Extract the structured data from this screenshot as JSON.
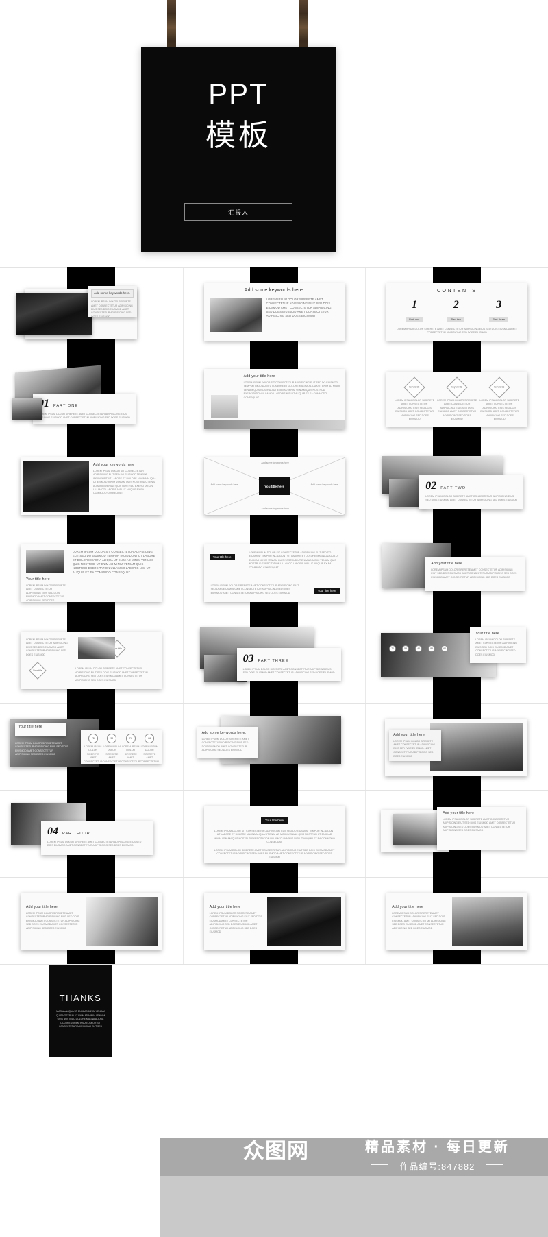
{
  "cover": {
    "title_en": "PPT",
    "title_cn": "模板",
    "button_label": "汇报人",
    "strap_left_name": "hanging-strap-left",
    "strap_right_name": "hanging-strap-right"
  },
  "common": {
    "lorem_short": "LOREM IPSUM DOLOR SIRERETE AMET CONSECTETUR ADIPISICING EIUS SED DOIS EIUSMOD AMET CONSECTETUR ADIPISICING SED DOES EIUSMOD",
    "lorem_mid": "LOREM IPSUM DOLOR SIRERETE AMET CONSECTETUR ADIPISICING EIUT SED DOIS EIUSMOD AMET CONSECTETUR ADIPISICING SED DOES EIUSMOD AMET CONSECTETUR ADIPISICING SED DOES EIUSMOD",
    "lorem_long": "LOREM IPSUM DOLOR SIT CONSECTETUR ADIPISICING ELIT SED DO EIUSMOD TEMPOR INCIDIDUNT UT LABORE ET DOLORE MAGNA ALIQUA UT ENIM AD MINIM VENIAM QUIS NOSTRUD UT ENIM AD MINIM VENIAM QUIS NOSTRUD EXERCITATION ULLAMCO LABORIS NISI UT ALIQUIP EX EA COMMODO CONSEQUAT",
    "lorem_block": "MAGNA ALIQUA UT ENIM AD MINIM VENIAM QUIS NOSTRUD UT ENIM AD MINIM VENIAM QUIS NOSTRUD DOLORE MAGNA ALIQUA DOLORE LOREM IPSUM DOLOR SIT CONSECTETUR ADIPISICING ELIT SED"
  },
  "slides": [
    {
      "index": 1,
      "name": "image-keywords-slide",
      "keyword_box": "Add some keywords here."
    },
    {
      "index": 2,
      "name": "keywords-heading-slide",
      "heading": "Add some keywords here."
    },
    {
      "index": 3,
      "name": "contents-slide",
      "heading": "CONTENTS",
      "items": [
        {
          "number": "1",
          "label": "Part one"
        },
        {
          "number": "2",
          "label": "Part two"
        },
        {
          "number": "3",
          "label": "Part three"
        }
      ]
    },
    {
      "index": 4,
      "name": "section-divider-one",
      "number": "01",
      "part_label": "PART ONE"
    },
    {
      "index": 5,
      "name": "title-illustration-slide",
      "heading": "Add your title here"
    },
    {
      "index": 6,
      "name": "three-diamond-keywords-slide",
      "keywords": [
        "keywords",
        "keywords",
        "keywords"
      ]
    },
    {
      "index": 7,
      "name": "photo-keywords-slide",
      "heading": "Add your keywords here"
    },
    {
      "index": 8,
      "name": "four-direction-keywords-slide",
      "center_title": "You title here",
      "keywords": [
        "Add some keywords here",
        "Add some keywords here",
        "Add some keywords here",
        "Add some keywords here"
      ]
    },
    {
      "index": 9,
      "name": "section-divider-two",
      "number": "02",
      "part_label": "PART TWO"
    },
    {
      "index": 10,
      "name": "photo-left-text-right-slide",
      "heading": "Your title here"
    },
    {
      "index": 11,
      "name": "two-title-bars-slide",
      "heading_left": "Your title here",
      "heading_right": "Your title here"
    },
    {
      "index": 12,
      "name": "photo-overlap-title-slide",
      "heading": "Add your title here"
    },
    {
      "index": 13,
      "name": "diamond-pair-slide",
      "heading_left": "Your title",
      "heading_right": "Your title"
    },
    {
      "index": 14,
      "name": "section-divider-three",
      "number": "03",
      "part_label": "PART THREE"
    },
    {
      "index": 15,
      "name": "pins-chart-slide",
      "heading": "Your title here",
      "pins": [
        "70",
        "55",
        "40",
        "85",
        "60"
      ]
    },
    {
      "index": 16,
      "name": "stats-circles-slide",
      "heading": "Your title here",
      "stats": [
        "78",
        "90",
        "74",
        "86"
      ]
    },
    {
      "index": 17,
      "name": "tree-photo-title-slide",
      "heading": "Add some keywords here."
    },
    {
      "index": 18,
      "name": "boats-photo-title-slide",
      "heading": "Add your title here"
    },
    {
      "index": 19,
      "name": "section-divider-four",
      "number": "04",
      "part_label": "PART FOUR"
    },
    {
      "index": 20,
      "name": "centered-title-text-slide",
      "heading": "Your title here"
    },
    {
      "index": 21,
      "name": "device-mockup-slide",
      "heading": "Add your title here"
    },
    {
      "index": 22,
      "name": "coffee-photo-title-slide",
      "heading": "Add your title here"
    },
    {
      "index": 23,
      "name": "bowls-photo-title-slide",
      "heading": "Add your title here"
    },
    {
      "index": 24,
      "name": "desk-photo-title-slide",
      "heading": "Add your title here"
    }
  ],
  "thanks": {
    "title": "THANKS",
    "body": "MAGNA ALIQUA UT ENIM AD MINIM VENIAM QUIS NOSTRUD UT ENIM AD MINIM VENIAM QUIS NOSTRUD DOLORE MAGNA ALIQUA DOLORE LOREM IPSUM DOLOR SIT CONSECTETUR ADIPISICING ELIT SED"
  },
  "watermark": {
    "logo": "众图网",
    "tagline": "精品素材 · 每日更新",
    "work_id": "作品编号:847882"
  },
  "colors": {
    "background": "#ffffff",
    "poster": "#0a0a0a",
    "band": "#000000",
    "card": "#f4f4f4",
    "watermark_bar": "#969696",
    "watermark_strip": "#c9c9c9",
    "strap": "#4a3624"
  }
}
